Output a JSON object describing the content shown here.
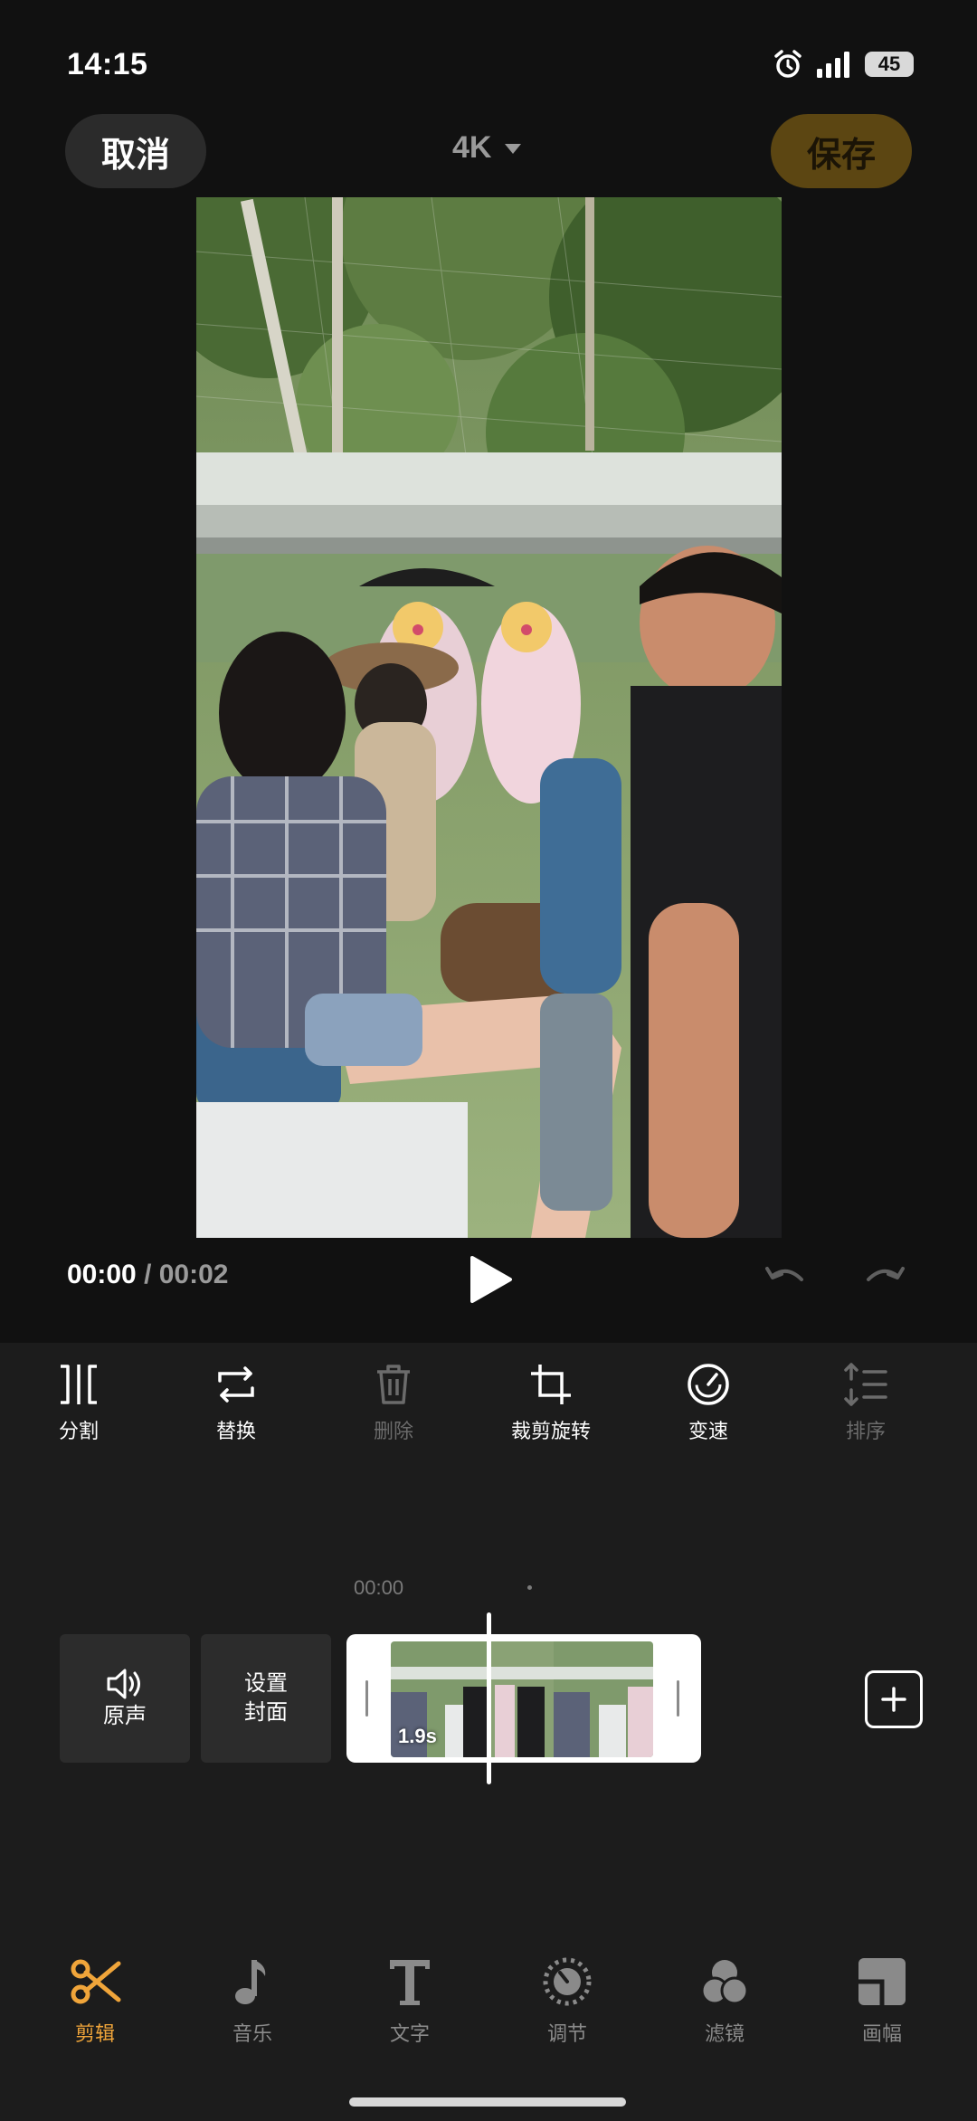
{
  "status_bar": {
    "time": "14:15",
    "battery": "45",
    "icons": [
      "alarm-icon",
      "signal-icon",
      "battery-icon"
    ]
  },
  "top_bar": {
    "cancel_label": "取消",
    "resolution": "4K",
    "save_label": "保存"
  },
  "playback": {
    "current": "00:00",
    "separator": " / ",
    "total": "00:02"
  },
  "tools": [
    {
      "label": "分割",
      "icon": "split-icon",
      "enabled": true
    },
    {
      "label": "替换",
      "icon": "replace-icon",
      "enabled": true
    },
    {
      "label": "删除",
      "icon": "trash-icon",
      "enabled": false
    },
    {
      "label": "裁剪旋转",
      "icon": "crop-icon",
      "enabled": true
    },
    {
      "label": "变速",
      "icon": "speedometer-icon",
      "enabled": true
    },
    {
      "label": "排序",
      "icon": "sort-icon",
      "enabled": false
    }
  ],
  "timeline": {
    "ruler_time": "00:00",
    "audio_label": "原声",
    "cover_line1": "设置",
    "cover_line2": "封面",
    "clip_duration": "1.9s"
  },
  "tabs": [
    {
      "label": "剪辑",
      "icon": "scissors-icon",
      "active": true
    },
    {
      "label": "音乐",
      "icon": "music-note-icon",
      "active": false
    },
    {
      "label": "文字",
      "icon": "text-icon",
      "active": false
    },
    {
      "label": "调节",
      "icon": "adjust-dial-icon",
      "active": false
    },
    {
      "label": "滤镜",
      "icon": "filter-icon",
      "active": false
    },
    {
      "label": "画幅",
      "icon": "aspect-ratio-icon",
      "active": false
    }
  ],
  "colors": {
    "accent": "#f0a53a",
    "save_button_bg": "#5c4612",
    "background": "#111111",
    "panel": "#1c1c1c"
  }
}
